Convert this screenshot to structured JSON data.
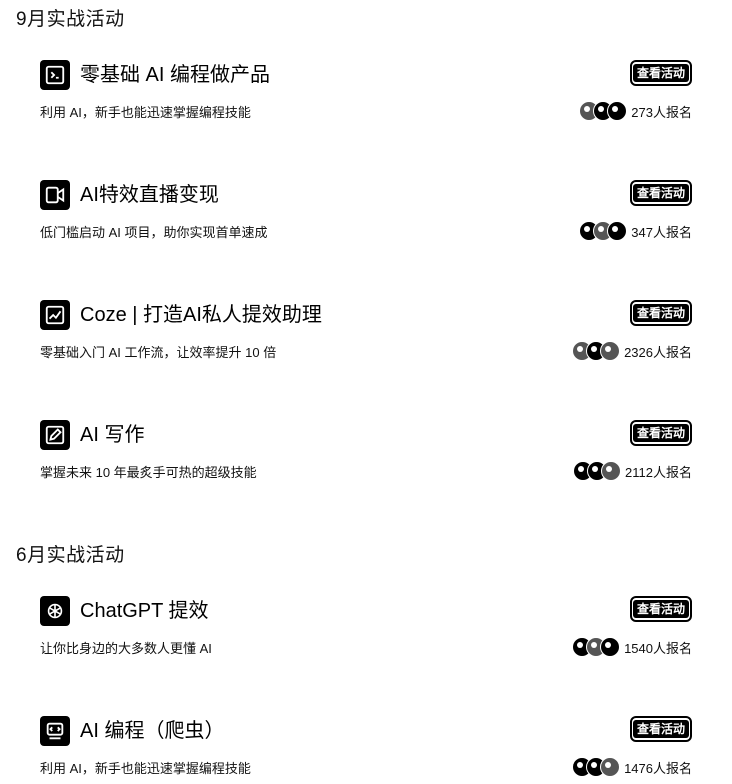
{
  "sections": [
    {
      "title": "9月实战活动",
      "cards": [
        {
          "icon": "box-code-icon",
          "title": "零基础 AI 编程做产品",
          "desc": "利用 AI，新手也能迅速掌握编程技能",
          "button": "查看活动",
          "signups": "273人报名"
        },
        {
          "icon": "video-effect-icon",
          "title": "AI特效直播变现",
          "desc": "低门槛启动 AI 项目，助你实现首单速成",
          "button": "查看活动",
          "signups": "347人报名"
        },
        {
          "icon": "growth-chart-icon",
          "title": "Coze | 打造AI私人提效助理",
          "desc": "零基础入门 AI 工作流，让效率提升 10 倍",
          "button": "查看活动",
          "signups": "2326人报名"
        },
        {
          "icon": "pen-write-icon",
          "title": "AI 写作",
          "desc": "掌握未来 10 年最炙手可热的超级技能",
          "button": "查看活动",
          "signups": "2112人报名"
        }
      ]
    },
    {
      "title": "6月实战活动",
      "cards": [
        {
          "icon": "chatgpt-logo-icon",
          "title": "ChatGPT 提效",
          "desc": "让你比身边的大多数人更懂 AI",
          "button": "查看活动",
          "signups": "1540人报名"
        },
        {
          "icon": "spider-code-icon",
          "title": "AI 编程（爬虫）",
          "desc": "利用 AI，新手也能迅速掌握编程技能",
          "button": "查看活动",
          "signups": "1476人报名"
        }
      ]
    }
  ]
}
